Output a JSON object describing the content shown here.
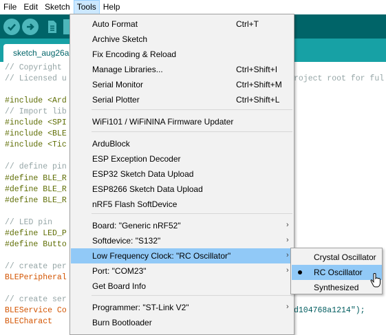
{
  "menubar": {
    "items": [
      "File",
      "Edit",
      "Sketch",
      "Tools",
      "Help"
    ]
  },
  "tab": {
    "label": "sketch_aug26a"
  },
  "editor": {
    "lines": [
      {
        "text": "// Copyright",
        "style": "comment"
      },
      {
        "text": "// Licensed u",
        "style": "comment",
        "tail": "roject root for ful"
      },
      {
        "text": "",
        "style": "plain"
      },
      {
        "text": "#include <Ard",
        "style": "include"
      },
      {
        "text": "// Import lib",
        "style": "comment"
      },
      {
        "text": "#include <SPI",
        "style": "include"
      },
      {
        "text": "#include <BLE",
        "style": "include"
      },
      {
        "text": "#include <Tic",
        "style": "include"
      },
      {
        "text": "",
        "style": "plain"
      },
      {
        "text": "// define pin",
        "style": "comment"
      },
      {
        "text": "#define BLE_R",
        "style": "define"
      },
      {
        "text": "#define BLE_R",
        "style": "define"
      },
      {
        "text": "#define BLE_R",
        "style": "define"
      },
      {
        "text": "",
        "style": "plain"
      },
      {
        "text": "// LED pin",
        "style": "comment"
      },
      {
        "text": "#define LED_P",
        "style": "define"
      },
      {
        "text": "#define Butto",
        "style": "define"
      },
      {
        "text": "",
        "style": "plain"
      },
      {
        "text": "// create per",
        "style": "comment"
      },
      {
        "text": "BLEPeripheral",
        "style": "type"
      },
      {
        "text": "",
        "style": "plain"
      },
      {
        "text": "// create ser",
        "style": "comment"
      },
      {
        "text": "BLEService Co",
        "style": "service",
        "tail": "d104768a1214\");"
      },
      {
        "text": "BLECharact",
        "style": "type",
        "tail": ""
      }
    ]
  },
  "tools_menu": {
    "items": [
      {
        "label": "Auto Format",
        "shortcut": "Ctrl+T"
      },
      {
        "label": "Archive Sketch",
        "shortcut": ""
      },
      {
        "label": "Fix Encoding & Reload",
        "shortcut": ""
      },
      {
        "label": "Manage Libraries...",
        "shortcut": "Ctrl+Shift+I"
      },
      {
        "label": "Serial Monitor",
        "shortcut": "Ctrl+Shift+M"
      },
      {
        "label": "Serial Plotter",
        "shortcut": "Ctrl+Shift+L"
      },
      {
        "label": "WiFi101 / WiFiNINA Firmware Updater",
        "shortcut": ""
      },
      {
        "label": "ArduBlock",
        "shortcut": ""
      },
      {
        "label": "ESP Exception Decoder",
        "shortcut": ""
      },
      {
        "label": "ESP32 Sketch Data Upload",
        "shortcut": ""
      },
      {
        "label": "ESP8266 Sketch Data Upload",
        "shortcut": ""
      },
      {
        "label": "nRF5 Flash SoftDevice",
        "shortcut": ""
      },
      {
        "label": "Board: \"Generic nRF52\"",
        "shortcut": ""
      },
      {
        "label": "Softdevice: \"S132\"",
        "shortcut": ""
      },
      {
        "label": "Low Frequency Clock: \"RC Oscillator\"",
        "shortcut": ""
      },
      {
        "label": "Port: \"COM23\"",
        "shortcut": ""
      },
      {
        "label": "Get Board Info",
        "shortcut": ""
      },
      {
        "label": "Programmer: \"ST-Link V2\"",
        "shortcut": ""
      },
      {
        "label": "Burn Bootloader",
        "shortcut": ""
      }
    ]
  },
  "submenu": {
    "items": [
      {
        "label": "Crystal Oscillator",
        "selected": false
      },
      {
        "label": "RC Oscillator",
        "selected": true
      },
      {
        "label": "Synthesized",
        "selected": false
      }
    ]
  },
  "colors": {
    "toolbar": "#006468",
    "tabrow": "#17a1a5",
    "menu_highlight": "#91c9f7",
    "menubar_active": "#cce8ff"
  }
}
